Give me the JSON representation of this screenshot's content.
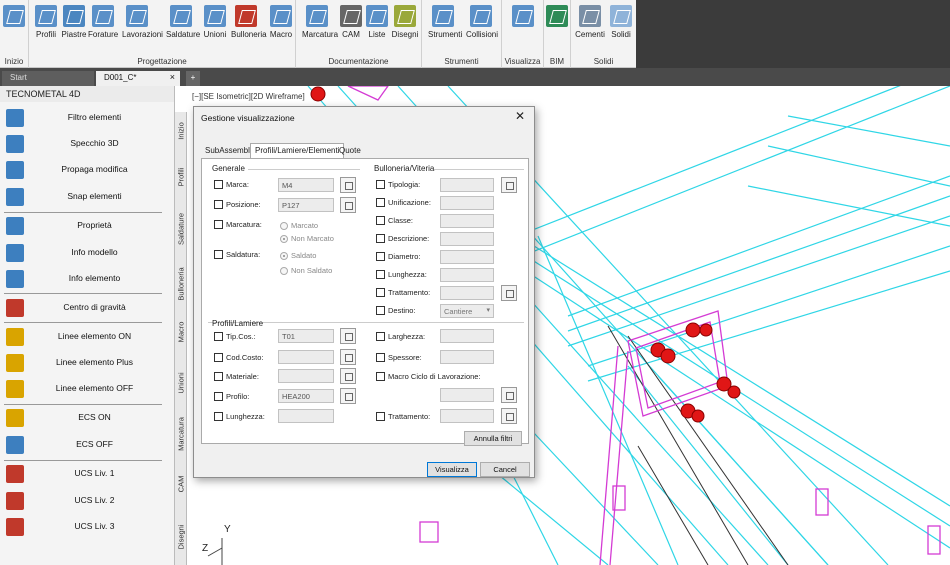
{
  "ribbon": {
    "groups": [
      {
        "label": "Inizio"
      },
      {
        "label": "Progettazione"
      },
      {
        "label": "Documentazione"
      },
      {
        "label": "Strumenti"
      },
      {
        "label": "Visualizza"
      },
      {
        "label": "BIM"
      },
      {
        "label": "Solidi"
      }
    ],
    "buttons": [
      {
        "label": "Profili"
      },
      {
        "label": "Piastre"
      },
      {
        "label": "Forature"
      },
      {
        "label": "Lavorazioni"
      },
      {
        "label": "Saldature"
      },
      {
        "label": "Unioni"
      },
      {
        "label": "Bulloneria"
      },
      {
        "label": "Macro"
      },
      {
        "label": "Marcatura"
      },
      {
        "label": "CAM"
      },
      {
        "label": "Liste"
      },
      {
        "label": "Disegni"
      },
      {
        "label": "Strumenti"
      },
      {
        "label": "Collisioni"
      },
      {
        "label": "Cementi"
      },
      {
        "label": "Solidi"
      }
    ]
  },
  "tabs": {
    "start": "Start",
    "doc": "D001_C*",
    "close": "×",
    "plus": "+"
  },
  "panel": {
    "title": "TECNOMETAL 4D",
    "items": [
      "Filtro elementi",
      "Specchio 3D",
      "Propaga modifica",
      "Snap elementi",
      "Proprietà",
      "Info modello",
      "Info elemento",
      "Centro di gravità",
      "Linee elemento ON",
      "Linee elemento Plus",
      "Linee elemento OFF",
      "ECS ON",
      "ECS OFF",
      "UCS Liv. 1",
      "UCS Liv. 2",
      "UCS Liv. 3"
    ],
    "vtabs": [
      "Inizio",
      "Profili",
      "Saldature",
      "Bulloneria",
      "Macro",
      "Unioni",
      "Marcatura",
      "CAM",
      "Disegni"
    ]
  },
  "viewport": {
    "label": "[−][SE Isometric][2D Wireframe]",
    "axis_y": "Y",
    "axis_z": "Z"
  },
  "dialog": {
    "title": "Gestione visualizzazione",
    "close": "✕",
    "tabs": [
      "SubAssembly",
      "Profili/Lamiere/Elementi",
      "Quote"
    ],
    "generale": {
      "title": "Generale",
      "marca": {
        "label": "Marca:",
        "value": "M4"
      },
      "posizione": {
        "label": "Posizione:",
        "value": "P127"
      },
      "marcatura": {
        "label": "Marcatura:",
        "opt1": "Marcato",
        "opt2": "Non Marcato"
      },
      "saldatura": {
        "label": "Saldatura:",
        "opt1": "Saldato",
        "opt2": "Non Saldato"
      }
    },
    "bulloneria": {
      "title": "Bulloneria/Viteria",
      "rows": [
        "Tipologia:",
        "Unificazione:",
        "Classe:",
        "Descrizione:",
        "Diametro:",
        "Lunghezza:",
        "Trattamento:",
        "Destino:"
      ],
      "destino_value": "Cantiere"
    },
    "profili": {
      "title": "Profili/Lamiere",
      "tipcos": {
        "label": "Tip.Cos.:",
        "value": "T01"
      },
      "codcosto": {
        "label": "Cod.Costo:",
        "value": ""
      },
      "materiale": {
        "label": "Materiale:",
        "value": ""
      },
      "profilo": {
        "label": "Profilo:",
        "value": "HEA200"
      },
      "lunghezza": {
        "label": "Lunghezza:",
        "value": ""
      }
    },
    "right_lower": {
      "larghezza": "Larghezza:",
      "spessore": "Spessore:",
      "macro": "Macro Ciclo di Lavorazione:",
      "trattamento": "Trattamento:"
    },
    "annulla_filtri": "Annulla filtri",
    "visualizza": "Visualizza",
    "cancel": "Cancel"
  }
}
